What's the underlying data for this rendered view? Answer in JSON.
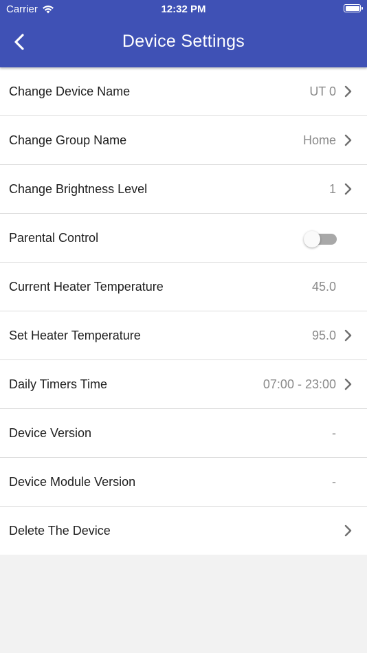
{
  "status_bar": {
    "carrier": "Carrier",
    "time": "12:32 PM",
    "wifi_icon": "wifi-icon",
    "battery_icon": "battery-icon"
  },
  "header": {
    "title": "Device Settings",
    "back_icon": "chevron-left-icon",
    "color": "#3f51b5"
  },
  "settings": {
    "device_name": {
      "label": "Change Device Name",
      "value": "UT 0"
    },
    "group_name": {
      "label": "Change Group Name",
      "value": "Home"
    },
    "brightness": {
      "label": "Change Brightness Level",
      "value": "1"
    },
    "parental_control": {
      "label": "Parental Control",
      "enabled": false
    },
    "current_temp": {
      "label": "Current Heater Temperature",
      "value": "45.0"
    },
    "set_temp": {
      "label": "Set Heater Temperature",
      "value": "95.0"
    },
    "daily_timers": {
      "label": "Daily Timers Time",
      "value": "07:00 - 23:00"
    },
    "device_version": {
      "label": "Device Version",
      "value": "-"
    },
    "module_version": {
      "label": "Device Module Version",
      "value": "-"
    },
    "delete_device": {
      "label": "Delete The Device"
    }
  }
}
